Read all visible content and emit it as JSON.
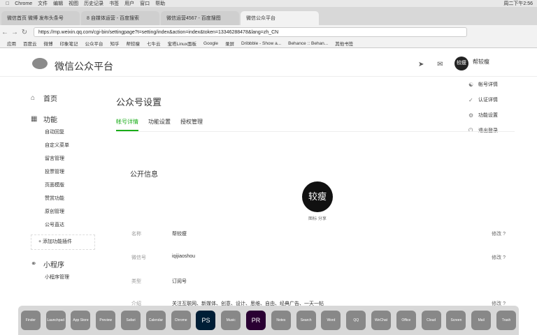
{
  "menubar": {
    "app": "Chrome",
    "items": [
      "文件",
      "编辑",
      "视图",
      "历史记录",
      "书签",
      "用户",
      "窗口",
      "帮助"
    ],
    "time": "周二下午2:56"
  },
  "tabs": [
    "微信首页 微博 发布头条号",
    "8 自媒体运营 - 百度搜索",
    "微信运营4567 - 百度搜图",
    "微信公众平台"
  ],
  "url": "https://mp.weixin.qq.com/cgi-bin/settingpage?t=setting/index&action=index&token=13346288478&lang=zh_CN",
  "bookmarks": [
    "应用",
    "百度云",
    "微博",
    "印象笔记",
    "公众平台",
    "知乎",
    "帮较瘦",
    "七牛云",
    "宝塔Linux面板",
    "Google",
    "录屏",
    "Dribbble - Show a...",
    "Behance :: Behan...",
    "其他书签"
  ],
  "header": {
    "logo": "微信公众平台",
    "username": "帮较瘦"
  },
  "dropdown": [
    {
      "icon": "account-icon",
      "label": "帐号详情"
    },
    {
      "icon": "verify-icon",
      "label": "认证详情"
    },
    {
      "icon": "gear-icon",
      "label": "功能设置"
    },
    {
      "icon": "logout-icon",
      "label": "退出登录"
    }
  ],
  "sidebar": {
    "home": "首页",
    "features": "功能",
    "items": [
      "自动回复",
      "自定义菜单",
      "留言管理",
      "投票管理",
      "页面模版",
      "赞赏功能",
      "原创管理",
      "公号直达"
    ],
    "add": "添加功能插件",
    "mini": "小程序",
    "mini_items": [
      "小程序管理"
    ]
  },
  "content": {
    "title": "公众号设置",
    "tabs": [
      "帐号详情",
      "功能设置",
      "授权管理"
    ],
    "section": "公开信息",
    "avatar_text": "较瘦",
    "avatar_caption": "图标 分享",
    "rows": [
      {
        "label": "名称",
        "value": "帮较瘦",
        "action": "修改 ?"
      },
      {
        "label": "微信号",
        "value": "iqijiaoshou",
        "action": "修改 ?"
      },
      {
        "label": "类型",
        "value": "订阅号",
        "action": ""
      },
      {
        "label": "介绍",
        "value": "关注互联网、新媒体、创意、设计、思维、自由、经典广告、一天一帖",
        "action": "修改 ?"
      }
    ]
  },
  "dock": [
    "Finder",
    "Launchpad",
    "App Store",
    "Preview",
    "Safari",
    "Calendar",
    "Chrome",
    "PS",
    "Music",
    "PR",
    "Notes",
    "Search",
    "Word",
    "QQ",
    "WeChat",
    "Office",
    "Cloud",
    "Screen",
    "Mail",
    "Trash"
  ]
}
